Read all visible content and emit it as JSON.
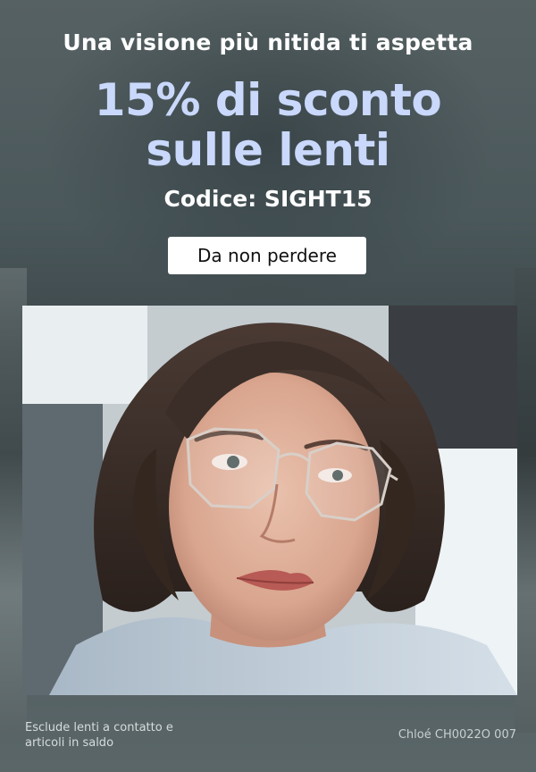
{
  "banner": {
    "headline": "Una visione più nitida ti aspetta",
    "promo_line1": "15% di sconto",
    "promo_line2": "sulle lenti",
    "code": "Codice: SIGHT15",
    "cta_label": "Da non perdere"
  },
  "photo": {
    "alt": "Donna con occhiali ottagonali"
  },
  "footer": {
    "disclaimer": "Esclude lenti a contatto e articoli in saldo",
    "model": "Chloé CH0022O 007"
  }
}
